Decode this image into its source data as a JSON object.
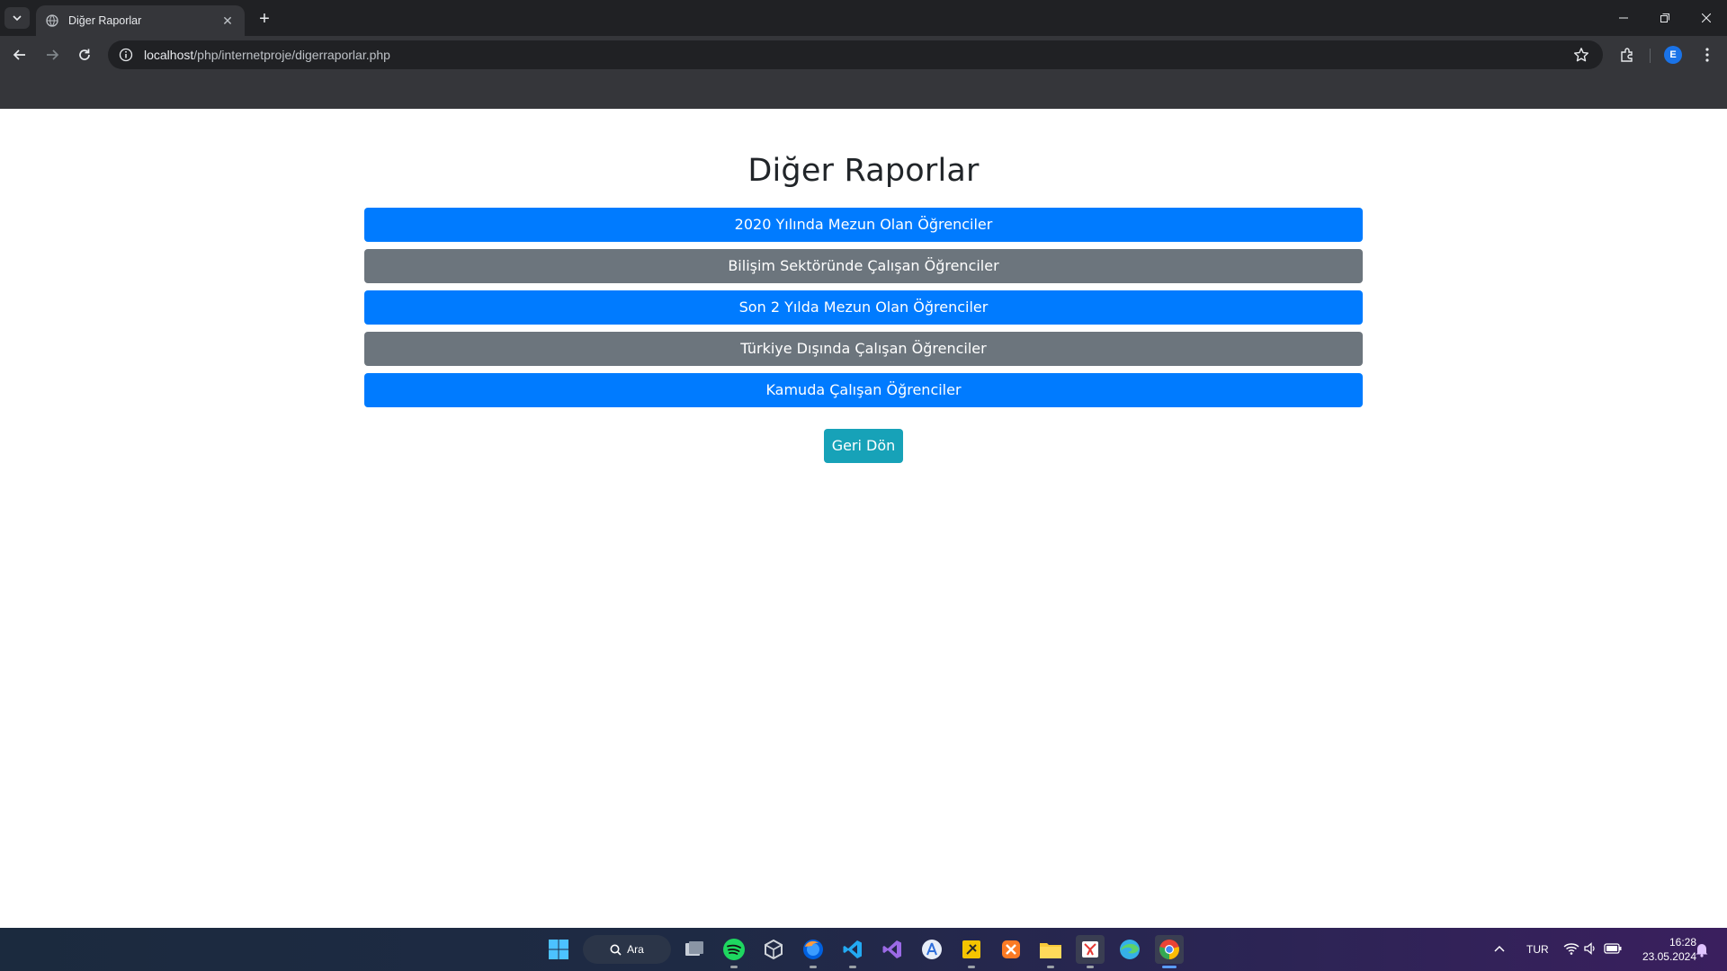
{
  "browser": {
    "tab_title": "Diğer Raporlar",
    "url_host": "localhost",
    "url_path": "/php/internetproje/digerraporlar.php",
    "profile_initial": "E"
  },
  "page": {
    "title": "Diğer Raporlar",
    "report_buttons": [
      {
        "label": "2020 Yılında Mezun Olan Öğrenciler",
        "style": "primary"
      },
      {
        "label": "Bilişim Sektöründe Çalışan Öğrenciler",
        "style": "secondary"
      },
      {
        "label": "Son 2 Yılda Mezun Olan Öğrenciler",
        "style": "primary"
      },
      {
        "label": "Türkiye Dışında Çalışan Öğrenciler",
        "style": "secondary"
      },
      {
        "label": "Kamuda Çalışan Öğrenciler",
        "style": "primary"
      }
    ],
    "back_button": "Geri Dön"
  },
  "colors": {
    "primary": "#007bff",
    "secondary": "#6c757d",
    "info": "#17a2b8"
  },
  "taskbar": {
    "search_label": "Ara",
    "language": "TUR",
    "time": "16:28",
    "date": "23.05.2024",
    "apps": [
      "windows-start-icon",
      "search-icon",
      "task-view-icon",
      "spotify-icon",
      "unity-icon",
      "firefox-icon",
      "vscode-icon",
      "visual-studio-icon",
      "app-store-icon",
      "sticky-notes-icon",
      "xampp-icon",
      "file-explorer-icon",
      "snipping-tool-icon",
      "edge-icon",
      "chrome-icon"
    ]
  }
}
